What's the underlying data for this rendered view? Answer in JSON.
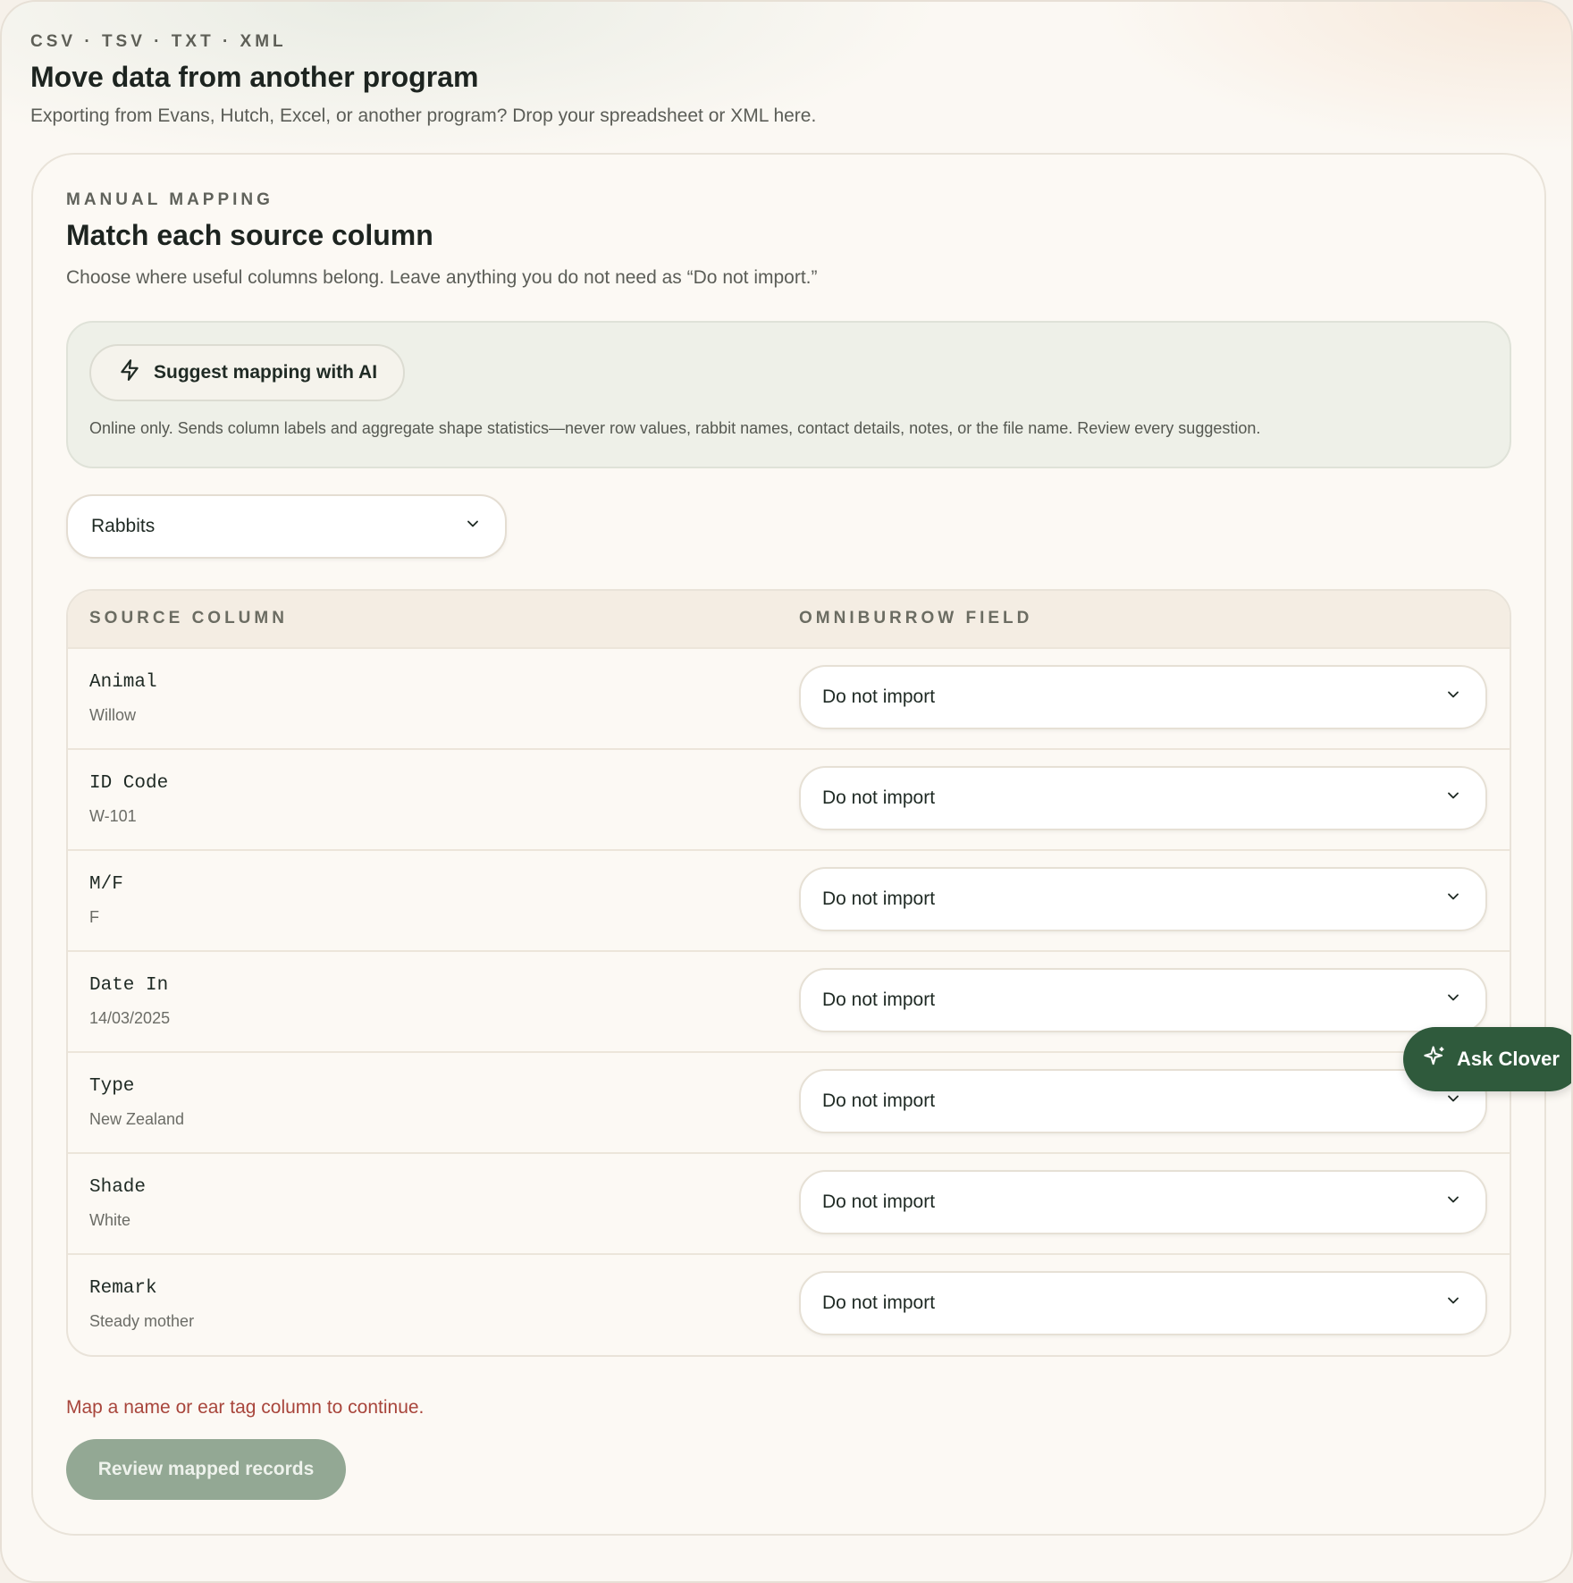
{
  "header": {
    "eyebrow": "CSV · TSV · TXT · XML",
    "title": "Move data from another program",
    "subtitle": "Exporting from Evans, Hutch, Excel, or another program? Drop your spreadsheet or XML here."
  },
  "mapping": {
    "eyebrow": "MANUAL MAPPING",
    "title": "Match each source column",
    "description": "Choose where useful columns belong. Leave anything you do not need as “Do not import.”",
    "ai": {
      "button_label": "Suggest mapping with AI",
      "note": "Online only. Sends column labels and aggregate shape statistics—never row values, rabbit names, contact details, notes, or the file name. Review every suggestion."
    },
    "record_type": {
      "selected": "Rabbits"
    },
    "table": {
      "headers": {
        "source": "SOURCE COLUMN",
        "field": "OMNIBURROW FIELD"
      },
      "rows": [
        {
          "column": "Animal",
          "sample": "Willow",
          "field": "Do not import"
        },
        {
          "column": "ID Code",
          "sample": "W-101",
          "field": "Do not import"
        },
        {
          "column": "M/F",
          "sample": "F",
          "field": "Do not import"
        },
        {
          "column": "Date In",
          "sample": "14/03/2025",
          "field": "Do not import"
        },
        {
          "column": "Type",
          "sample": "New Zealand",
          "field": "Do not import"
        },
        {
          "column": "Shade",
          "sample": "White",
          "field": "Do not import"
        },
        {
          "column": "Remark",
          "sample": "Steady mother",
          "field": "Do not import"
        }
      ]
    },
    "error": "Map a name or ear tag column to continue.",
    "review_button": "Review mapped records"
  },
  "assistant": {
    "label": "Ask Clover",
    "icon": "sparkle-icon"
  },
  "icons": {
    "ai": "lightning-icon",
    "dropdown": "chevron-down-icon"
  },
  "colors": {
    "accent": "#2f5a3c",
    "error": "#a8453b",
    "disabled_button": "#93a894"
  }
}
